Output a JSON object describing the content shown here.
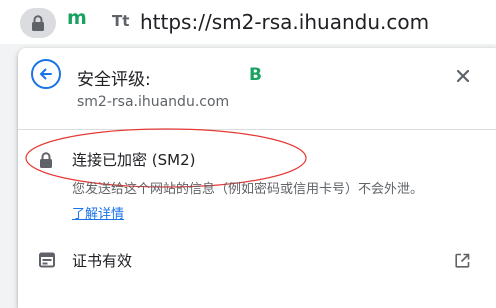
{
  "address_bar": {
    "url": "https://sm2-rsa.ihuandu.com",
    "extension_icon": "m",
    "tt_icon": "Tt"
  },
  "popup": {
    "title": "安全评级:",
    "grade": "B",
    "domain": "sm2-rsa.ihuandu.com",
    "connection": {
      "status": "连接已加密 (SM2)",
      "description": "您发送给这个网站的信息（例如密码或信用卡号）不会外泄。",
      "learn_more": "了解详情"
    },
    "certificate": {
      "label": "证书有效"
    }
  },
  "colors": {
    "accent": "#1a73e8",
    "grade": "#1aa260",
    "annotation": "#e53935"
  }
}
